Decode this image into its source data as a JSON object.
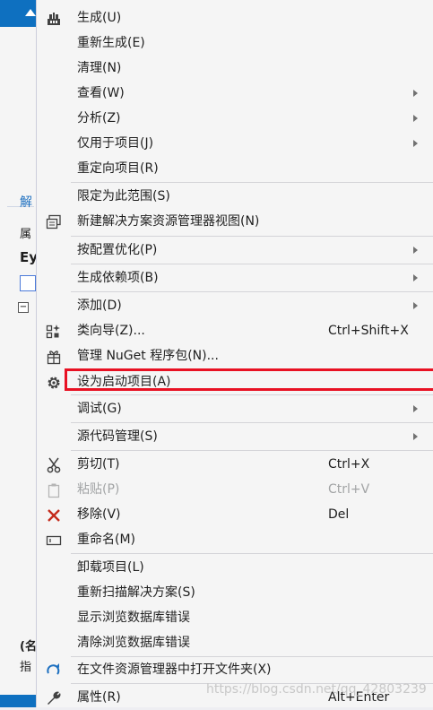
{
  "background": {
    "label_solution": "解",
    "label_properties": "属",
    "label_ey": "Ey",
    "label_name": "(名",
    "label_ref": "指"
  },
  "menu": {
    "items": [
      {
        "label": "生成(U)",
        "icon": "build-icon",
        "submenu": false
      },
      {
        "label": "重新生成(E)",
        "icon": "",
        "submenu": false
      },
      {
        "label": "清理(N)",
        "icon": "",
        "submenu": false
      },
      {
        "label": "查看(W)",
        "icon": "",
        "submenu": true
      },
      {
        "label": "分析(Z)",
        "icon": "",
        "submenu": true
      },
      {
        "label": "仅用于项目(J)",
        "icon": "",
        "submenu": true
      },
      {
        "label": "重定向项目(R)",
        "icon": "",
        "submenu": false
      },
      {
        "label": "限定为此范围(S)",
        "icon": "",
        "submenu": false
      },
      {
        "label": "新建解决方案资源管理器视图(N)",
        "icon": "new-view-icon",
        "submenu": false
      },
      {
        "label": "按配置优化(P)",
        "icon": "",
        "submenu": true
      },
      {
        "label": "生成依赖项(B)",
        "icon": "",
        "submenu": true
      },
      {
        "label": "添加(D)",
        "icon": "",
        "submenu": true
      },
      {
        "label": "类向导(Z)...",
        "icon": "class-wizard-icon",
        "shortcut": "Ctrl+Shift+X"
      },
      {
        "label": "管理 NuGet 程序包(N)...",
        "icon": "nuget-icon"
      },
      {
        "label": "设为启动项目(A)",
        "icon": "gear-icon",
        "highlighted": true
      },
      {
        "label": "调试(G)",
        "icon": "",
        "submenu": true
      },
      {
        "label": "源代码管理(S)",
        "icon": "",
        "submenu": true
      },
      {
        "label": "剪切(T)",
        "icon": "scissors-icon",
        "shortcut": "Ctrl+X"
      },
      {
        "label": "粘贴(P)",
        "icon": "paste-icon",
        "shortcut": "Ctrl+V",
        "disabled": true
      },
      {
        "label": "移除(V)",
        "icon": "remove-x-icon",
        "shortcut": "Del"
      },
      {
        "label": "重命名(M)",
        "icon": "rename-icon"
      },
      {
        "label": "卸载项目(L)",
        "icon": ""
      },
      {
        "label": "重新扫描解决方案(S)",
        "icon": ""
      },
      {
        "label": "显示浏览数据库错误",
        "icon": ""
      },
      {
        "label": "清除浏览数据库错误",
        "icon": ""
      },
      {
        "label": "在文件资源管理器中打开文件夹(X)",
        "icon": "open-folder-icon"
      },
      {
        "label": "属性(R)",
        "icon": "wrench-icon",
        "shortcut": "Alt+Enter"
      }
    ]
  },
  "colors": {
    "highlight_border": "#e81123",
    "remove_icon": "#c42b1c",
    "folder_arrow": "#1e70c0"
  },
  "watermark": "https://blog.csdn.net/qq_42803239"
}
